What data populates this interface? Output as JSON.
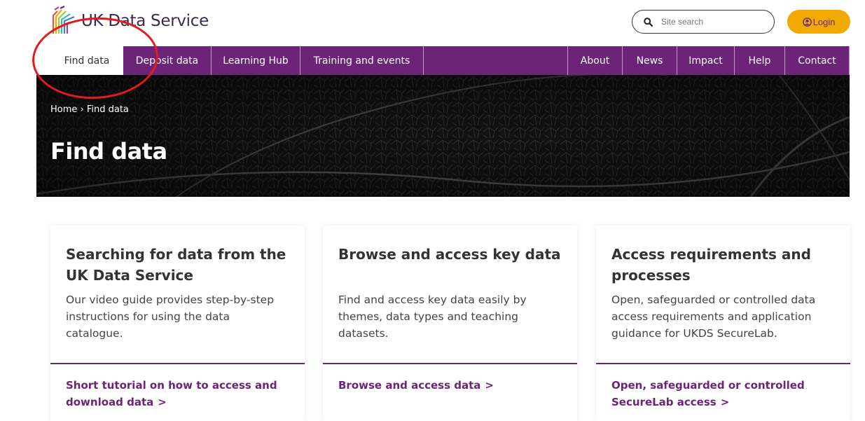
{
  "header": {
    "logo_text": "UK Data Service",
    "search_placeholder": "Site search",
    "login_label": "Login"
  },
  "nav": {
    "left": [
      "Find data",
      "Deposit data",
      "Learning Hub",
      "Training and events"
    ],
    "right": [
      "About",
      "News",
      "Impact",
      "Help",
      "Contact"
    ],
    "active": "Find data"
  },
  "hero": {
    "breadcrumb": "Home › Find data",
    "title": "Find data"
  },
  "cards": [
    {
      "title": "Searching for data from the UK Data Service",
      "description": "Our video guide provides step-by-step instructions for using the data catalogue.",
      "link": "Short tutorial on how to access and download data",
      "arrow": ">"
    },
    {
      "title": "Browse and access key data",
      "description": "Find and access key data easily by themes, data types and teaching datasets.",
      "link": "Browse and access data",
      "arrow": ">"
    },
    {
      "title": "Access requirements and processes",
      "description": "Open, safeguarded or controlled data access requirements and application guidance for UKDS SecureLab.",
      "link": "Open, safeguarded or controlled SecureLab access",
      "arrow": ">"
    }
  ],
  "colors": {
    "brand_purple": "#6b2477",
    "login_yellow": "#f2a900",
    "annotation_red": "#e31b1b"
  }
}
